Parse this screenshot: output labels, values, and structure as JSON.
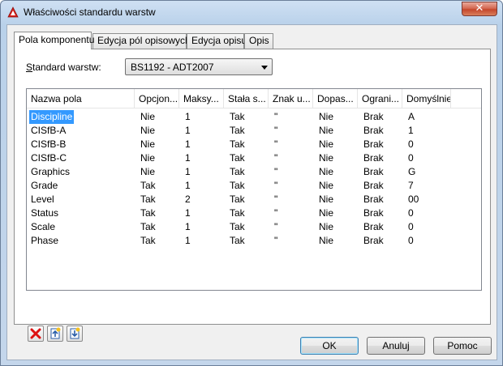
{
  "window": {
    "title": "Właściwości standardu warstw"
  },
  "tabs": [
    {
      "label": "Pola komponentu"
    },
    {
      "label": "Edycja pól opisowych"
    },
    {
      "label": "Edycja opisu"
    },
    {
      "label": "Opis"
    }
  ],
  "standard": {
    "label_prefix": "S",
    "label_rest": "tandard warstw:",
    "value": "BS1192 - ADT2007"
  },
  "grid": {
    "headers": [
      "Nazwa pola",
      "Opcjon...",
      "Maksy...",
      "Stała s...",
      "Znak u...",
      "Dopas...",
      "Ograni...",
      "Domyślnie"
    ],
    "rows": [
      [
        "Discipline",
        "Nie",
        "1",
        "Tak",
        "\"",
        "Nie",
        "Brak",
        "A"
      ],
      [
        "CISfB-A",
        "Nie",
        "1",
        "Tak",
        "\"",
        "Nie",
        "Brak",
        "1"
      ],
      [
        "CISfB-B",
        "Nie",
        "1",
        "Tak",
        "\"",
        "Nie",
        "Brak",
        "0"
      ],
      [
        "CISfB-C",
        "Nie",
        "1",
        "Tak",
        "\"",
        "Nie",
        "Brak",
        "0"
      ],
      [
        "Graphics",
        "Nie",
        "1",
        "Tak",
        "\"",
        "Nie",
        "Brak",
        "G"
      ],
      [
        "Grade",
        "Tak",
        "1",
        "Tak",
        "\"",
        "Nie",
        "Brak",
        "7"
      ],
      [
        "Level",
        "Tak",
        "2",
        "Tak",
        "\"",
        "Nie",
        "Brak",
        "00"
      ],
      [
        "Status",
        "Tak",
        "1",
        "Tak",
        "\"",
        "Nie",
        "Brak",
        "0"
      ],
      [
        "Scale",
        "Tak",
        "1",
        "Tak",
        "\"",
        "Nie",
        "Brak",
        "0"
      ],
      [
        "Phase",
        "Tak",
        "1",
        "Tak",
        "\"",
        "Nie",
        "Brak",
        "0"
      ]
    ],
    "selected_row": 0
  },
  "icons": {
    "delete": "delete-icon",
    "move_up": "move-up-icon",
    "move_down": "move-down-icon"
  },
  "buttons": {
    "ok": "OK",
    "cancel": "Anuluj",
    "help": "Pomoc"
  }
}
